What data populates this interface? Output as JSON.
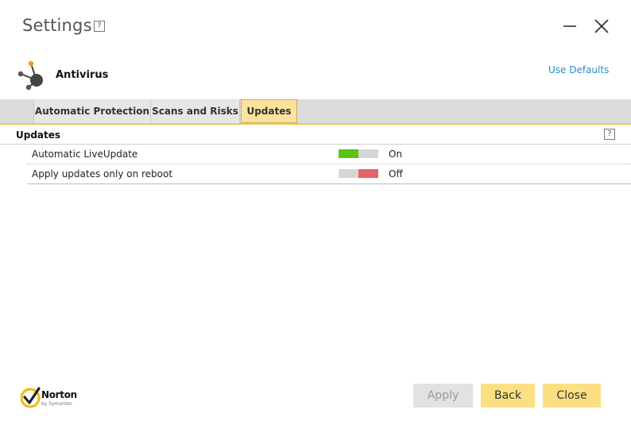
{
  "window": {
    "title": "Settings",
    "help_label": "?"
  },
  "header": {
    "app_name": "Antivirus",
    "use_defaults_label": "Use Defaults"
  },
  "tabs": [
    {
      "label": "Automatic Protection",
      "active": false
    },
    {
      "label": "Scans and Risks",
      "active": false
    },
    {
      "label": "Updates",
      "active": true
    }
  ],
  "section": {
    "title": "Updates",
    "help_label": "?"
  },
  "settings": [
    {
      "label": "Automatic LiveUpdate",
      "state": "On"
    },
    {
      "label": "Apply updates only on reboot",
      "state": "Off"
    }
  ],
  "brand": {
    "name": "Norton",
    "sub": "by Symantec"
  },
  "buttons": {
    "apply": "Apply",
    "back": "Back",
    "close": "Close"
  },
  "colors": {
    "accent": "#f5c842",
    "active_tab": "#fce29a",
    "toggle_on": "#5cc21a",
    "toggle_off": "#e86264",
    "link": "#2a8ec4",
    "button": "#fddf83"
  },
  "icons": [
    "help-icon",
    "minimize-icon",
    "close-icon",
    "antivirus-icon",
    "norton-check-icon"
  ]
}
